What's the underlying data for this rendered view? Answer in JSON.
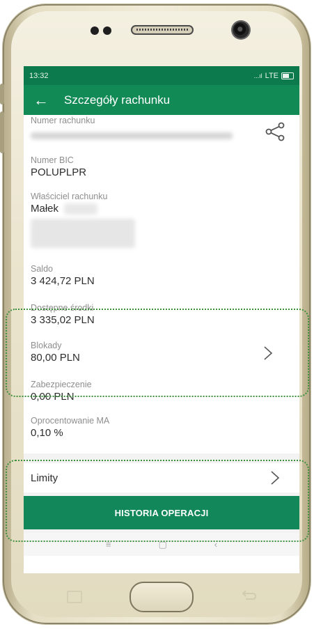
{
  "status_bar": {
    "time": "13:32",
    "network": "LTE"
  },
  "app_bar": {
    "back_icon": "arrow-left-icon",
    "title": "Szczegóły rachunku"
  },
  "details": {
    "account_number_label": "Numer rachunku",
    "bic_label": "Numer BIC",
    "bic_value": "POLUPLPR",
    "owner_label": "Właściciel rachunku",
    "owner_value": "Małek",
    "saldo_label": "Saldo",
    "saldo_value": "3 424,72 PLN",
    "available_label": "Dostępne środki",
    "available_value": "3 335,02 PLN",
    "blocks_label": "Blokady",
    "blocks_value": "80,00 PLN",
    "deposit_label": "Zabezpieczenie",
    "deposit_value": "0,00 PLN",
    "interest_label": "Oprocentowanie MA",
    "interest_value": "0,10 %"
  },
  "limity_label": "Limity",
  "history_button": "HISTORIA OPERACJI",
  "nav": {
    "menu": "≡",
    "home": "▢",
    "back": "‹"
  },
  "colors": {
    "primary": "#128a56",
    "status_bar": "#0c7a4c",
    "highlight": "#3b8f3b"
  }
}
